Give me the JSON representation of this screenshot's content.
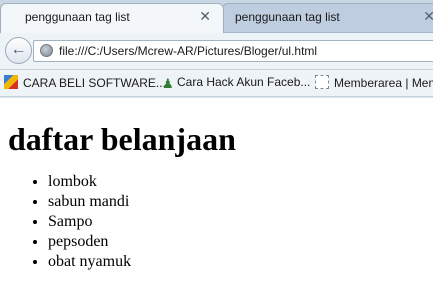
{
  "browser": {
    "tabs": [
      {
        "title": "penggunaan tag list",
        "active": true
      },
      {
        "title": "penggunaan tag list",
        "active": false
      }
    ],
    "address": "file:///C:/Users/Mcrew-AR/Pictures/Bloger/ul.html",
    "bookmarks": [
      {
        "label": "CARA BELI SOFTWARE..."
      },
      {
        "label": "Cara Hack Akun Faceb..."
      },
      {
        "label": "Memberarea | Mem"
      }
    ]
  },
  "page": {
    "heading": "daftar belanjaan",
    "items": [
      "lombok",
      "sabun mandi",
      "Sampo",
      "pepsoden",
      "obat nyamuk"
    ]
  }
}
